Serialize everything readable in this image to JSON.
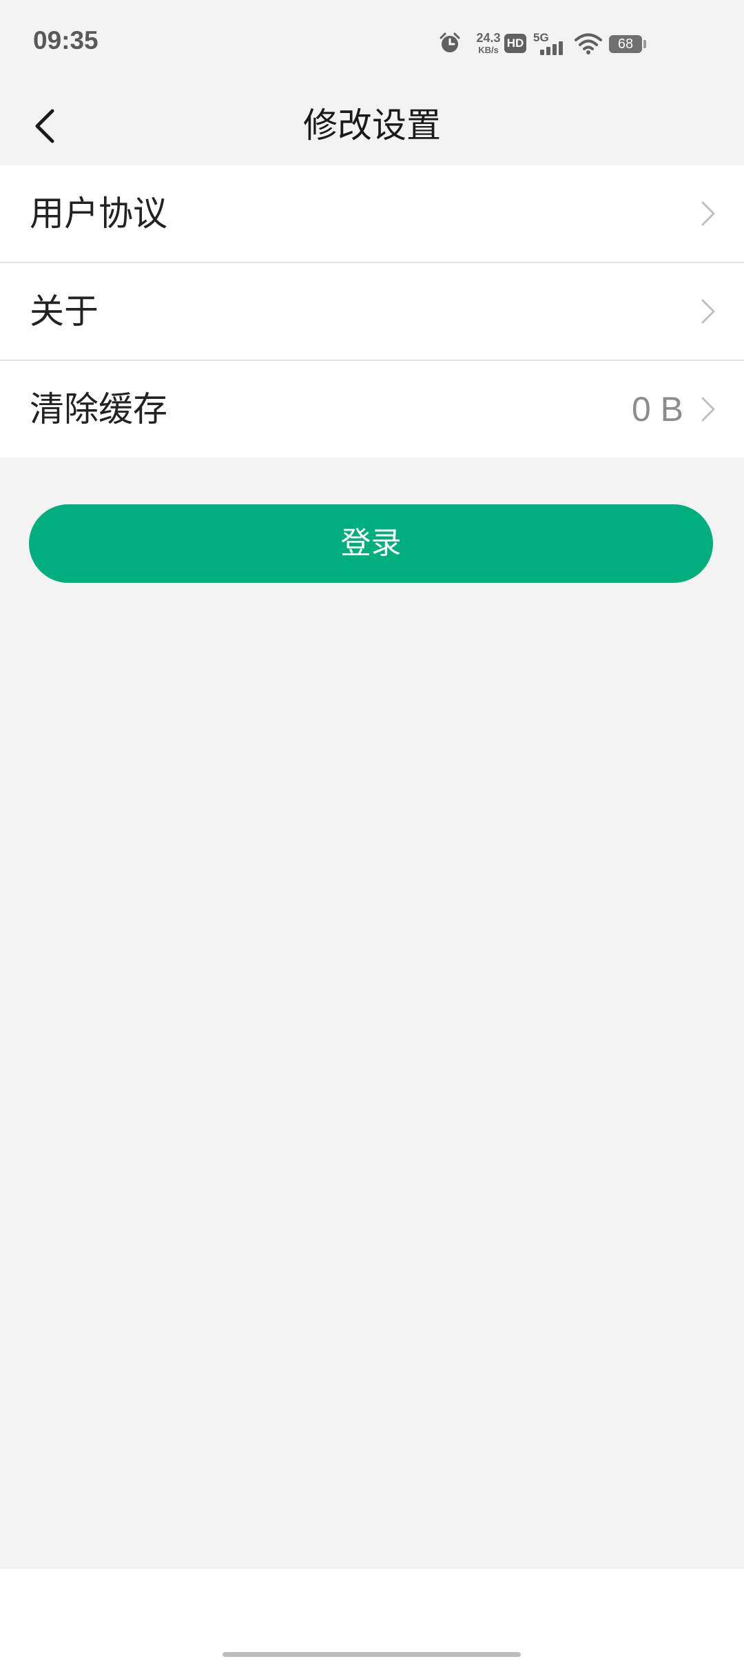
{
  "status_bar": {
    "time": "09:35",
    "net_speed_value": "24.3",
    "net_speed_unit": "KB/s",
    "hd_label": "HD",
    "network_label": "5G",
    "battery_level": "68",
    "icons": [
      "alarm-icon",
      "hd-icon",
      "signal-icon",
      "wifi-icon",
      "battery-icon"
    ]
  },
  "header": {
    "title": "修改设置",
    "back_icon": "chevron-left-icon"
  },
  "settings": {
    "items": [
      {
        "label": "用户协议",
        "value": ""
      },
      {
        "label": "关于",
        "value": ""
      },
      {
        "label": "清除缓存",
        "value": "0 B"
      }
    ],
    "chevron_icon": "chevron-right-icon"
  },
  "login": {
    "label": "登录"
  },
  "colors": {
    "accent": "#00ae7e",
    "page_background": "#f3f3f3",
    "list_background": "#ffffff",
    "title_text": "#1a1a1a",
    "secondary_text": "#8c8c8c",
    "chevron": "#bfbfbf"
  }
}
